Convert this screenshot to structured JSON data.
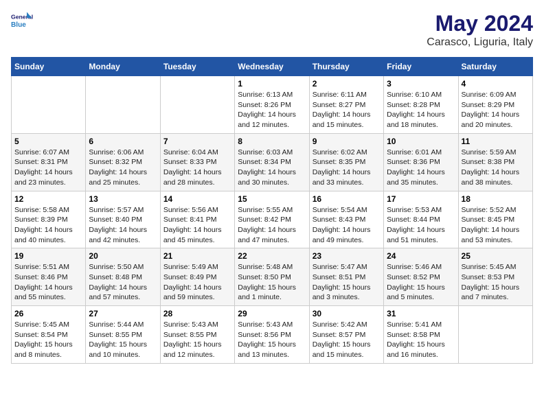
{
  "logo": {
    "line1": "General",
    "line2": "Blue"
  },
  "title": "May 2024",
  "subtitle": "Carasco, Liguria, Italy",
  "days": [
    "Sunday",
    "Monday",
    "Tuesday",
    "Wednesday",
    "Thursday",
    "Friday",
    "Saturday"
  ],
  "weeks": [
    [
      {
        "day": "",
        "content": ""
      },
      {
        "day": "",
        "content": ""
      },
      {
        "day": "",
        "content": ""
      },
      {
        "day": "1",
        "content": "Sunrise: 6:13 AM\nSunset: 8:26 PM\nDaylight: 14 hours\nand 12 minutes."
      },
      {
        "day": "2",
        "content": "Sunrise: 6:11 AM\nSunset: 8:27 PM\nDaylight: 14 hours\nand 15 minutes."
      },
      {
        "day": "3",
        "content": "Sunrise: 6:10 AM\nSunset: 8:28 PM\nDaylight: 14 hours\nand 18 minutes."
      },
      {
        "day": "4",
        "content": "Sunrise: 6:09 AM\nSunset: 8:29 PM\nDaylight: 14 hours\nand 20 minutes."
      }
    ],
    [
      {
        "day": "5",
        "content": "Sunrise: 6:07 AM\nSunset: 8:31 PM\nDaylight: 14 hours\nand 23 minutes."
      },
      {
        "day": "6",
        "content": "Sunrise: 6:06 AM\nSunset: 8:32 PM\nDaylight: 14 hours\nand 25 minutes."
      },
      {
        "day": "7",
        "content": "Sunrise: 6:04 AM\nSunset: 8:33 PM\nDaylight: 14 hours\nand 28 minutes."
      },
      {
        "day": "8",
        "content": "Sunrise: 6:03 AM\nSunset: 8:34 PM\nDaylight: 14 hours\nand 30 minutes."
      },
      {
        "day": "9",
        "content": "Sunrise: 6:02 AM\nSunset: 8:35 PM\nDaylight: 14 hours\nand 33 minutes."
      },
      {
        "day": "10",
        "content": "Sunrise: 6:01 AM\nSunset: 8:36 PM\nDaylight: 14 hours\nand 35 minutes."
      },
      {
        "day": "11",
        "content": "Sunrise: 5:59 AM\nSunset: 8:38 PM\nDaylight: 14 hours\nand 38 minutes."
      }
    ],
    [
      {
        "day": "12",
        "content": "Sunrise: 5:58 AM\nSunset: 8:39 PM\nDaylight: 14 hours\nand 40 minutes."
      },
      {
        "day": "13",
        "content": "Sunrise: 5:57 AM\nSunset: 8:40 PM\nDaylight: 14 hours\nand 42 minutes."
      },
      {
        "day": "14",
        "content": "Sunrise: 5:56 AM\nSunset: 8:41 PM\nDaylight: 14 hours\nand 45 minutes."
      },
      {
        "day": "15",
        "content": "Sunrise: 5:55 AM\nSunset: 8:42 PM\nDaylight: 14 hours\nand 47 minutes."
      },
      {
        "day": "16",
        "content": "Sunrise: 5:54 AM\nSunset: 8:43 PM\nDaylight: 14 hours\nand 49 minutes."
      },
      {
        "day": "17",
        "content": "Sunrise: 5:53 AM\nSunset: 8:44 PM\nDaylight: 14 hours\nand 51 minutes."
      },
      {
        "day": "18",
        "content": "Sunrise: 5:52 AM\nSunset: 8:45 PM\nDaylight: 14 hours\nand 53 minutes."
      }
    ],
    [
      {
        "day": "19",
        "content": "Sunrise: 5:51 AM\nSunset: 8:46 PM\nDaylight: 14 hours\nand 55 minutes."
      },
      {
        "day": "20",
        "content": "Sunrise: 5:50 AM\nSunset: 8:48 PM\nDaylight: 14 hours\nand 57 minutes."
      },
      {
        "day": "21",
        "content": "Sunrise: 5:49 AM\nSunset: 8:49 PM\nDaylight: 14 hours\nand 59 minutes."
      },
      {
        "day": "22",
        "content": "Sunrise: 5:48 AM\nSunset: 8:50 PM\nDaylight: 15 hours\nand 1 minute."
      },
      {
        "day": "23",
        "content": "Sunrise: 5:47 AM\nSunset: 8:51 PM\nDaylight: 15 hours\nand 3 minutes."
      },
      {
        "day": "24",
        "content": "Sunrise: 5:46 AM\nSunset: 8:52 PM\nDaylight: 15 hours\nand 5 minutes."
      },
      {
        "day": "25",
        "content": "Sunrise: 5:45 AM\nSunset: 8:53 PM\nDaylight: 15 hours\nand 7 minutes."
      }
    ],
    [
      {
        "day": "26",
        "content": "Sunrise: 5:45 AM\nSunset: 8:54 PM\nDaylight: 15 hours\nand 8 minutes."
      },
      {
        "day": "27",
        "content": "Sunrise: 5:44 AM\nSunset: 8:55 PM\nDaylight: 15 hours\nand 10 minutes."
      },
      {
        "day": "28",
        "content": "Sunrise: 5:43 AM\nSunset: 8:55 PM\nDaylight: 15 hours\nand 12 minutes."
      },
      {
        "day": "29",
        "content": "Sunrise: 5:43 AM\nSunset: 8:56 PM\nDaylight: 15 hours\nand 13 minutes."
      },
      {
        "day": "30",
        "content": "Sunrise: 5:42 AM\nSunset: 8:57 PM\nDaylight: 15 hours\nand 15 minutes."
      },
      {
        "day": "31",
        "content": "Sunrise: 5:41 AM\nSunset: 8:58 PM\nDaylight: 15 hours\nand 16 minutes."
      },
      {
        "day": "",
        "content": ""
      }
    ]
  ]
}
